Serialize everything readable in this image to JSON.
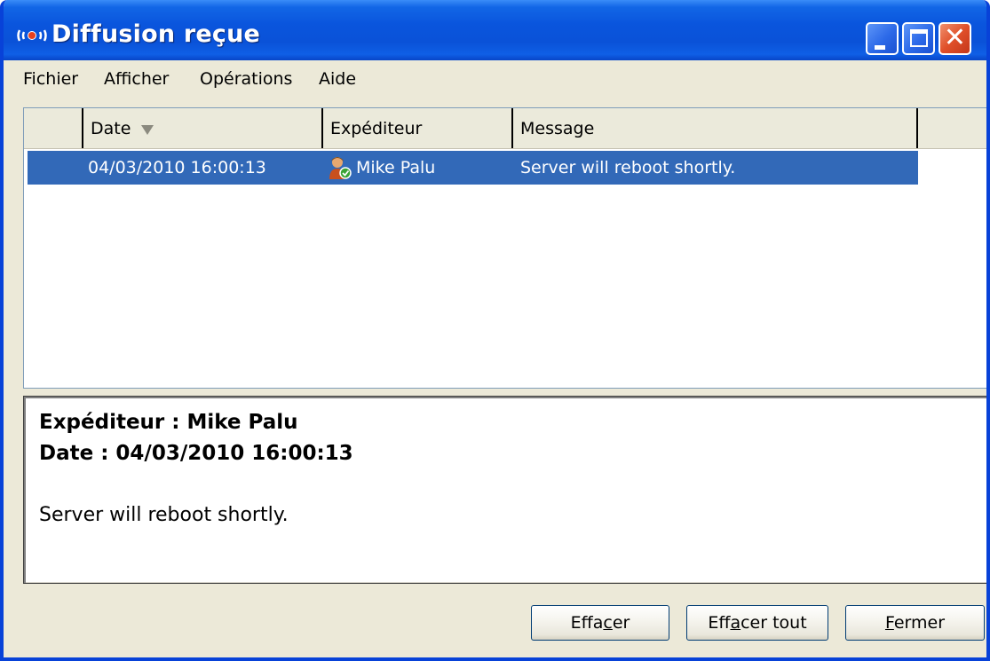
{
  "window": {
    "title": "Diffusion reçue",
    "buttons": {
      "minimize": "minimize",
      "maximize": "maximize",
      "close": "close"
    }
  },
  "menu": [
    "Fichier",
    "Afficher",
    "Opérations",
    "Aide"
  ],
  "list": {
    "columns": {
      "date": "Date",
      "sender": "Expéditeur",
      "message": "Message"
    },
    "sort_column": "Date",
    "rows": [
      {
        "date": "04/03/2010 16:00:13",
        "sender": "Mike Palu",
        "message": "Server will reboot shortly.",
        "selected": true
      }
    ]
  },
  "detail": {
    "sender_line": "Expéditeur : Mike Palu",
    "date_line": "Date : 04/03/2010 16:00:13",
    "body": "Server will reboot shortly."
  },
  "buttons": {
    "clear": {
      "pre": "Effa",
      "key": "c",
      "post": "er"
    },
    "clear_all": {
      "pre": "Eff",
      "key": "a",
      "post": "cer tout"
    },
    "close": {
      "pre": "",
      "key": "F",
      "post": "ermer"
    }
  },
  "colors": {
    "titlebar": "#0a55dd",
    "selection": "#3269b8",
    "face": "#ece9d8"
  },
  "icons": {
    "app": "broadcast-icon",
    "sender": "user-online-icon"
  }
}
